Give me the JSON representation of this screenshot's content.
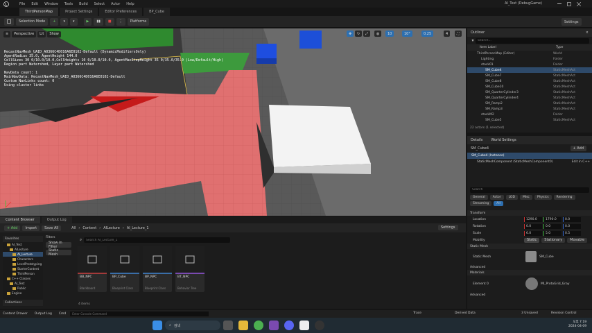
{
  "window": {
    "title": "AI_Test (DebugGame)",
    "menu": [
      "File",
      "Edit",
      "Window",
      "Tools",
      "Build",
      "Select",
      "Actor",
      "Help"
    ],
    "tabs": [
      "ThirdPersonMap",
      "Project Settings",
      "Editor Preferences",
      "BP_Cube"
    ],
    "settings_label": "Settings"
  },
  "toolbar": {
    "selection_mode": "Selection Mode",
    "platforms": "Platforms"
  },
  "viewport": {
    "perspective": "Perspective",
    "lit": "Lit",
    "show": "Show",
    "grid_snap": "10",
    "rot_snap": "10°",
    "scale_snap": "0.25",
    "cam_speed": "4",
    "stats_lines": [
      "RecastNavMesh_UAID_A0366C4D016A6E0102-Default (DynamicModifiersOnly)",
      "AgentRadius 35.0, AgentHeight 144.0",
      "CellSizes 30 0/10.0/10.0,CellHeights 10 0/10.0/10.0, AgentMaxStepHeight 35 0/35.0/35.0 (Low/Default/High)",
      "Region part Watershed, Layer part Watershed",
      "",
      "NavData count: 1",
      "MainNavData: RecastNavMesh_UAID_A0366C4D016A6E0102-Default",
      "Custom NavLinks count: 0",
      "Using cluster links"
    ]
  },
  "outliner": {
    "title": "Outliner",
    "search_placeholder": "Search...",
    "col_label": "Item Label",
    "col_type": "Type",
    "rows": [
      {
        "label": "ThirdPersonMap (Editor)",
        "type": "World"
      },
      {
        "label": "Lighting",
        "type": "Folder"
      },
      {
        "label": "stack01",
        "type": "Folder"
      },
      {
        "label": "SM_Cube4",
        "type": "StaticMeshAct"
      },
      {
        "label": "SM_Cube7",
        "type": "StaticMeshAct"
      },
      {
        "label": "SM_Cube8",
        "type": "StaticMeshAct"
      },
      {
        "label": "SM_Cube10",
        "type": "StaticMeshAct"
      },
      {
        "label": "SM_QuarterCylinder3",
        "type": "StaticMeshAct"
      },
      {
        "label": "SM_QuarterCylinder4",
        "type": "StaticMeshAct"
      },
      {
        "label": "SM_Ramp2",
        "type": "StaticMeshAct"
      },
      {
        "label": "SM_Ramp3",
        "type": "StaticMeshAct"
      },
      {
        "label": "stackM2",
        "type": "Folder"
      },
      {
        "label": "SM_Cube5",
        "type": "StaticMeshAct"
      }
    ],
    "footer": "22 actors (1 selected)"
  },
  "details": {
    "tab_details": "Details",
    "tab_world": "World Settings",
    "actor_name": "SM_Cube4",
    "add_label": "+ Add",
    "component_root": "SM_Cube4 (Instance)",
    "component_child": "StaticMeshComponent (StaticMeshComponent0)",
    "edit_label": "Edit in C++",
    "search_placeholder": "Search",
    "filters": [
      "General",
      "Actor",
      "LOD",
      "Misc",
      "Physics",
      "Rendering",
      "Streaming",
      "All"
    ],
    "transform_title": "Transform",
    "location_label": "Location",
    "rotation_label": "Rotation",
    "scale_label": "Scale",
    "location": [
      "1290.0",
      "1790.0",
      "0.0"
    ],
    "rotation": [
      "0.0",
      "0.0",
      "0.0"
    ],
    "scale": [
      "6.0",
      "5.0",
      "0.5"
    ],
    "mobility_label": "Mobility",
    "mobility": [
      "Static",
      "Stationary",
      "Movable"
    ],
    "static_mesh_title": "Static Mesh",
    "static_mesh_label": "Static Mesh",
    "static_mesh_value": "SM_Cube",
    "advanced1": "Advanced",
    "materials_title": "Materials",
    "element0": "Element 0",
    "material_value": "MI_ProtoGrid_Gray",
    "advanced2": "Advanced"
  },
  "content_browser": {
    "tab_cb": "Content Browser",
    "tab_output": "Output Log",
    "add_label": "+ Add",
    "import_label": "Import",
    "save_all": "Save All",
    "path": [
      "All",
      "Content",
      "AILecture",
      "AI_Lecture_1"
    ],
    "settings": "Settings",
    "favorites": "Favorites",
    "filters": "Filters",
    "search_placeholder": "Search AI_Lecture_1",
    "tree": [
      "AI_Test",
      "AILecture",
      "AI_Lecture",
      "Characters",
      "LevelPrototyping",
      "StarterContent",
      "ThirdPerson",
      "C++ Classes",
      "AI_Test",
      "Public",
      "Engine"
    ],
    "filter_buttons": [
      "Show in Filter",
      "Static Mesh"
    ],
    "assets": [
      {
        "name": "BB_NPC",
        "sub": "Blackboard",
        "color": "#a33a3a"
      },
      {
        "name": "BP_Cube",
        "sub": "Blueprint Class",
        "color": "#3a6ea8"
      },
      {
        "name": "BP_NPC",
        "sub": "Blueprint Class",
        "color": "#3a6ea8"
      },
      {
        "name": "BT_NPC",
        "sub": "Behavior Tree",
        "color": "#7a4ab0"
      }
    ],
    "item_count": "4 items",
    "collections": "Collections"
  },
  "statusbar": {
    "content_drawer": "Content Drawer",
    "output_log": "Output Log",
    "cmd": "Cmd",
    "console_placeholder": "Enter Console Command",
    "trace": "Trace",
    "derived_data": "Derived Data",
    "unsaved": "3 Unsaved",
    "revision": "Revision Control"
  },
  "taskbar": {
    "search": "검색",
    "time": "오후 7:19",
    "date": "2024-04-09"
  }
}
